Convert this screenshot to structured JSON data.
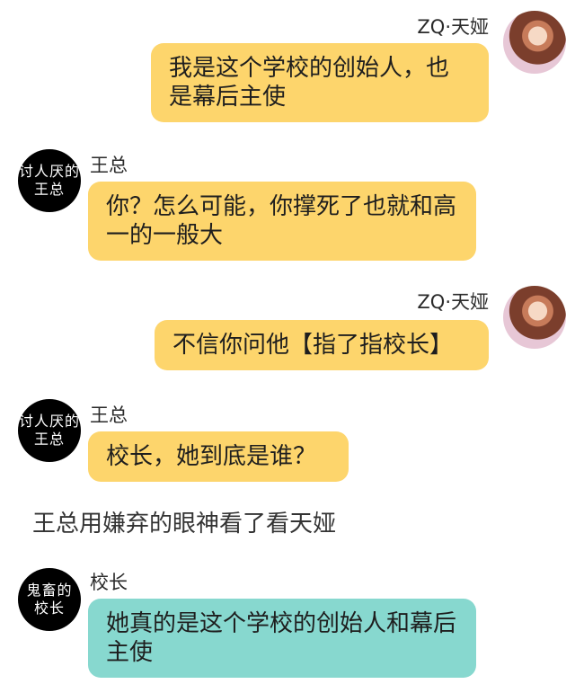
{
  "messages": [
    {
      "side": "right",
      "name": "ZQ·天娅",
      "text": "我是这个学校的创始人，也是幕后主使",
      "color": "#fdd56c",
      "avatar": "anime-girl-avatar"
    },
    {
      "side": "left",
      "name": "王总",
      "text": "你？怎么可能，你撑死了也就和高一的一般大",
      "color": "#fdd56c",
      "avatar_text": "讨人厌的\n王总"
    },
    {
      "side": "right",
      "name": "ZQ·天娅",
      "text": "不信你问他【指了指校长】",
      "color": "#fdd56c",
      "avatar": "anime-girl-avatar"
    },
    {
      "side": "left",
      "name": "王总",
      "text": "校长，她到底是谁？",
      "color": "#fdd56c",
      "avatar_text": "讨人厌的\n王总"
    },
    {
      "side": "left",
      "name": "校长",
      "text": "她真的是这个学校的创始人和幕后主使",
      "color": "#87d8cf",
      "avatar_text": "鬼畜的\n校长"
    }
  ],
  "narration": "王总用嫌弃的眼神看了看天娅",
  "avatars": {
    "wangzong_line1": "讨人厌的",
    "wangzong_line2": "王总",
    "xiaozhang_line1": "鬼畜的",
    "xiaozhang_line2": "校长"
  }
}
